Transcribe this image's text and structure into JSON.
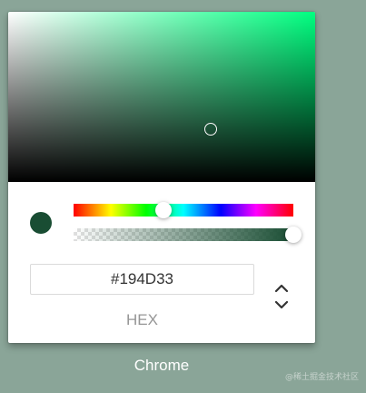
{
  "picker": {
    "hue_color": "#00ff80",
    "current_color": "#194D33",
    "hue_level": 0.41,
    "alpha_level": 1.0,
    "saturation_position": {
      "s": 0.67,
      "v": 0.3
    }
  },
  "hex": {
    "value": "#194D33",
    "label": "HEX"
  },
  "toggle": {
    "icon": "chevron-up-down-icon"
  },
  "caption": "Chrome",
  "watermark": "@稀土掘金技术社区"
}
